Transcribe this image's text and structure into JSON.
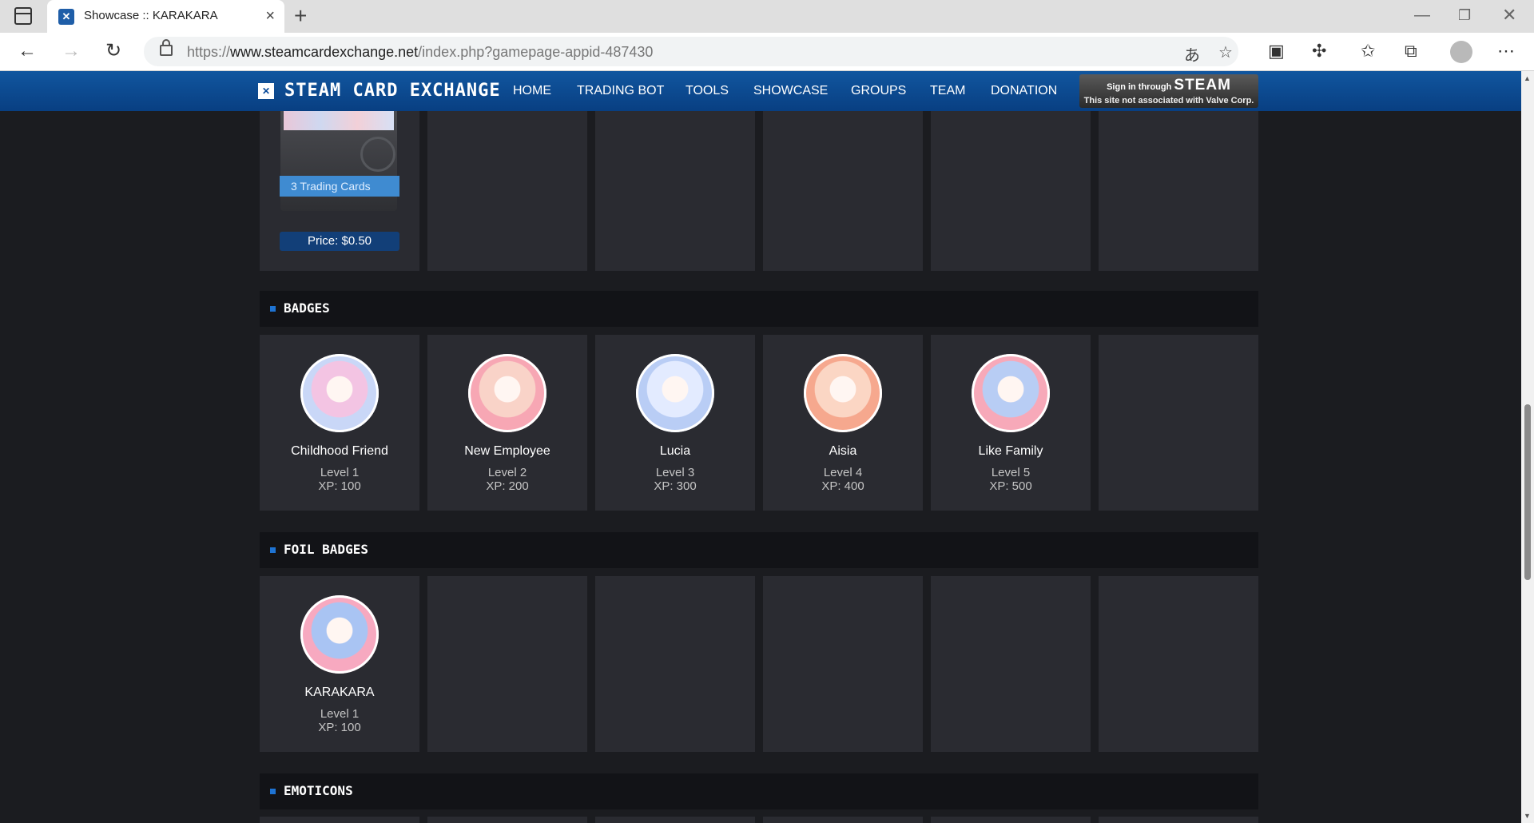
{
  "browser": {
    "tab_title": "Showcase :: KARAKARA",
    "url_prefix": "https://",
    "url_host": "www.steamcardexchange.net",
    "url_path": "/index.php?gamepage-appid-487430"
  },
  "site": {
    "logo": "STEAM CARD EXCHANGE",
    "nav": [
      "HOME",
      "TRADING BOT",
      "TOOLS",
      "SHOWCASE",
      "GROUPS",
      "TEAM",
      "DONATION"
    ],
    "signin_prefix": "Sign in through",
    "signin_brand": "STEAM",
    "signin_note": "This site not associated with Valve Corp."
  },
  "booster": {
    "ribbon": "3 Trading Cards",
    "price": "Price: $0.50"
  },
  "badges": {
    "title": "BADGES",
    "items": [
      {
        "name": "Childhood Friend",
        "level": "Level 1",
        "xp": "XP: 100",
        "c1": "#c9d7f7",
        "c2": "#f3c4e3"
      },
      {
        "name": "New Employee",
        "level": "Level 2",
        "xp": "XP: 200",
        "c1": "#f7a7b4",
        "c2": "#f9d3c8"
      },
      {
        "name": "Lucia",
        "level": "Level 3",
        "xp": "XP: 300",
        "c1": "#b9cdf5",
        "c2": "#e3ebff"
      },
      {
        "name": "Aisia",
        "level": "Level 4",
        "xp": "XP: 400",
        "c1": "#f6a88e",
        "c2": "#fbd6c4"
      },
      {
        "name": "Like Family",
        "level": "Level 5",
        "xp": "XP: 500",
        "c1": "#f7a9b9",
        "c2": "#b8cdf4"
      }
    ]
  },
  "foil_badges": {
    "title": "FOIL BADGES",
    "items": [
      {
        "name": "KARAKARA",
        "level": "Level 1",
        "xp": "XP: 100",
        "c1": "#f7a9c0",
        "c2": "#a9c4f3"
      }
    ]
  },
  "emoticons": {
    "title": "EMOTICONS"
  }
}
